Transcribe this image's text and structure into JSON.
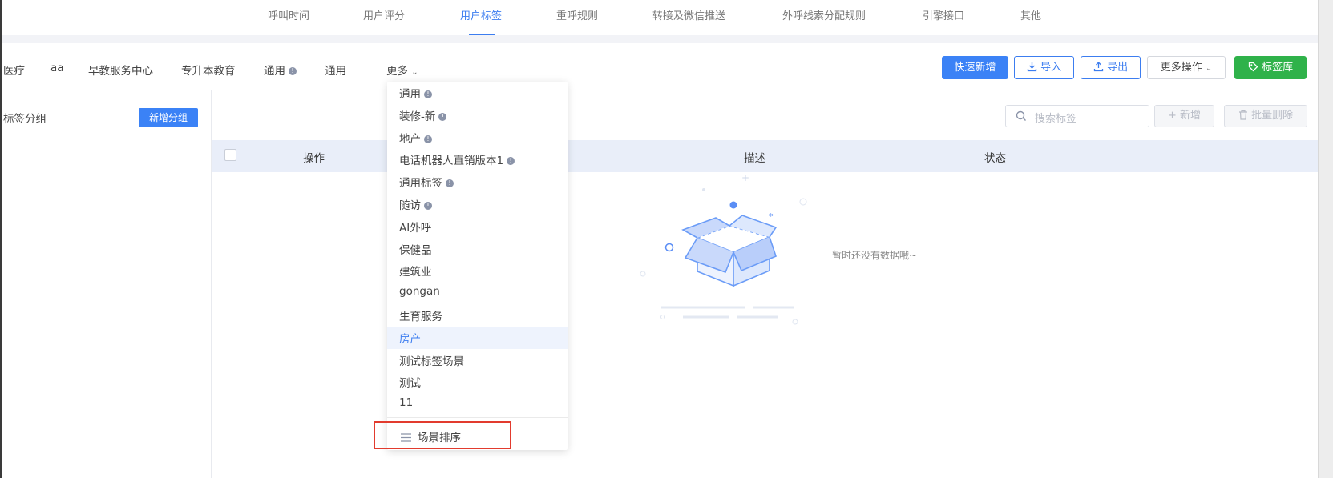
{
  "tabs": [
    {
      "label": "呼叫时间",
      "active": false
    },
    {
      "label": "用户评分",
      "active": false
    },
    {
      "label": "用户标签",
      "active": true
    },
    {
      "label": "重呼规则",
      "active": false
    },
    {
      "label": "转接及微信推送",
      "active": false
    },
    {
      "label": "外呼线索分配规则",
      "active": false
    },
    {
      "label": "引擎接口",
      "active": false
    },
    {
      "label": "其他",
      "active": false
    }
  ],
  "scenes": [
    "医疗",
    "aa",
    "早教服务中心",
    "专升本教育",
    "通用",
    "通用"
  ],
  "more_label": "更多",
  "buttons": {
    "quick_add": "快速新增",
    "import": "导入",
    "export": "导出",
    "more_ops": "更多操作",
    "tag_library": "标签库"
  },
  "left": {
    "title": "标签分组",
    "add_group": "新增分组"
  },
  "search": {
    "placeholder": "搜索标签"
  },
  "actions": {
    "add": "+ 新增",
    "batch_delete": "批量删除"
  },
  "table": {
    "headers": [
      "操作",
      "描述",
      "状态"
    ]
  },
  "empty_text": "暂时还没有数据哦~",
  "dropdown": {
    "items": [
      {
        "label": "通用",
        "info": true
      },
      {
        "label": "装修-新",
        "info": true
      },
      {
        "label": "地产",
        "info": true
      },
      {
        "label": "电话机器人直销版本1",
        "info": true
      },
      {
        "label": "通用标签",
        "info": true
      },
      {
        "label": "随访",
        "info": true
      },
      {
        "label": "AI外呼",
        "info": false
      },
      {
        "label": "保健品",
        "info": false
      },
      {
        "label": "建筑业",
        "info": false
      },
      {
        "label": "gongan",
        "info": false
      },
      {
        "label": "生育服务",
        "info": false
      },
      {
        "label": "房产",
        "info": false,
        "selected": true
      },
      {
        "label": "测试标签场景",
        "info": false
      },
      {
        "label": "测试",
        "info": false
      },
      {
        "label": "11",
        "info": false
      }
    ],
    "sort_label": "场景排序"
  },
  "colors": {
    "primary": "#3b82f6",
    "green": "#2fb24a",
    "highlight_red": "#e23b2e"
  }
}
